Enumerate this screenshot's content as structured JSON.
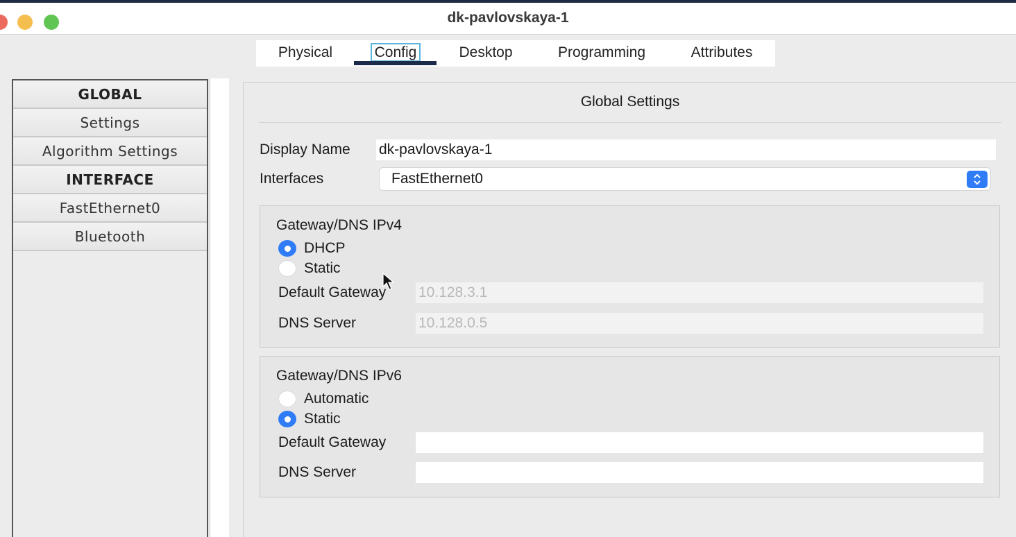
{
  "window": {
    "title": "dk-pavlovskaya-1"
  },
  "tabs": [
    {
      "label": "Physical"
    },
    {
      "label": "Config"
    },
    {
      "label": "Desktop"
    },
    {
      "label": "Programming"
    },
    {
      "label": "Attributes"
    }
  ],
  "active_tab": "Config",
  "sidebar": {
    "items": [
      {
        "label": "GLOBAL",
        "type": "header"
      },
      {
        "label": "Settings",
        "type": "item"
      },
      {
        "label": "Algorithm Settings",
        "type": "item"
      },
      {
        "label": "INTERFACE",
        "type": "header"
      },
      {
        "label": "FastEthernet0",
        "type": "item"
      },
      {
        "label": "Bluetooth",
        "type": "item"
      }
    ]
  },
  "main": {
    "title": "Global Settings",
    "display_name_label": "Display Name",
    "display_name_value": "dk-pavlovskaya-1",
    "interfaces_label": "Interfaces",
    "interfaces_value": "FastEthernet0",
    "ipv4": {
      "title": "Gateway/DNS IPv4",
      "option_dhcp": "DHCP",
      "option_static": "Static",
      "selected": "DHCP",
      "gateway_label": "Default Gateway",
      "gateway_value": "10.128.3.1",
      "dns_label": "DNS Server",
      "dns_value": "10.128.0.5"
    },
    "ipv6": {
      "title": "Gateway/DNS IPv6",
      "option_automatic": "Automatic",
      "option_static": "Static",
      "selected": "Static",
      "gateway_label": "Default Gateway",
      "gateway_value": "",
      "dns_label": "DNS Server",
      "dns_value": ""
    }
  },
  "colors": {
    "accent": "#2f7cf6",
    "tab_underline": "#1c2a4a",
    "traffic_close": "#ec6a5e",
    "traffic_min": "#f4bf4f",
    "traffic_max": "#61c554"
  },
  "icons": [
    "select-stepper-icon",
    "mouse-cursor-icon"
  ]
}
